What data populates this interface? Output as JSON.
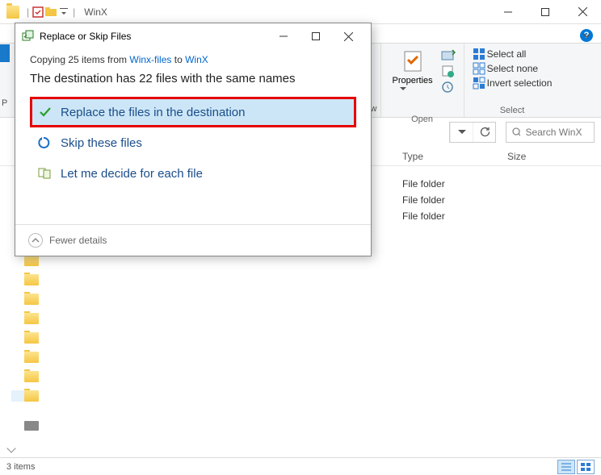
{
  "window": {
    "title": "WinX",
    "min_tooltip": "Minimize",
    "max_tooltip": "Maximize",
    "close_tooltip": "Close"
  },
  "ribbon": {
    "tab_view_suffix": "iew",
    "group_open": "Open",
    "group_select": "Select",
    "properties": "Properties",
    "select_all": "Select all",
    "select_none": "Select none",
    "invert_selection": "Invert selection"
  },
  "search": {
    "placeholder": "Search WinX"
  },
  "columns": {
    "type": "Type",
    "size": "Size"
  },
  "rows": [
    {
      "type": "File folder"
    },
    {
      "type": "File folder"
    },
    {
      "type": "File folder"
    }
  ],
  "status": {
    "items": "3 items"
  },
  "dialog": {
    "title": "Replace or Skip Files",
    "copying_prefix": "Copying 25 items from ",
    "copying_src": "Winx-files",
    "copying_mid": " to ",
    "copying_dst": "WinX",
    "heading": "The destination has 22 files with the same names",
    "opt_replace": "Replace the files in the destination",
    "opt_skip": "Skip these files",
    "opt_decide": "Let me decide for each file",
    "fewer": "Fewer details"
  }
}
